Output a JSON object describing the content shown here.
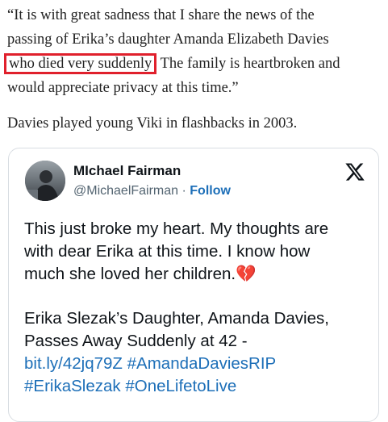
{
  "article": {
    "quote_line_1": "“It is with great sadness that I share the news of the",
    "quote_line_2": "passing of Erika’s daughter Amanda Elizabeth Davies",
    "quote_line_3_highlight": "who died very suddenly",
    "quote_line_3_rest": "The family is heartbroken and",
    "quote_line_4": "would appreciate privacy at this time.”",
    "caption": "Davies played young Viki in flashbacks in 2003.",
    "highlight_color": "#e0202c"
  },
  "tweet": {
    "author_name": "MIchael Fairman",
    "handle": "@MichaelFairman",
    "separator": " · ",
    "follow_label": "Follow",
    "platform_icon": "x-logo-icon",
    "body_line_1": "This just broke my heart. My thoughts are",
    "body_line_2": "with dear Erika at this time. I know how",
    "body_line_3": "much she loved her children.",
    "emoji": "💔",
    "headline_line_1": "Erika Slezak’s Daughter, Amanda Davies,",
    "headline_line_2": "Passes Away Suddenly at 42 -",
    "link_url": "bit.ly/42jq79Z",
    "hashtag_1": "#AmandaDaviesRIP",
    "hashtag_2": "#ErikaSlezak",
    "hashtag_3": "#OneLifetoLive",
    "link_color": "#1d6fb8"
  }
}
